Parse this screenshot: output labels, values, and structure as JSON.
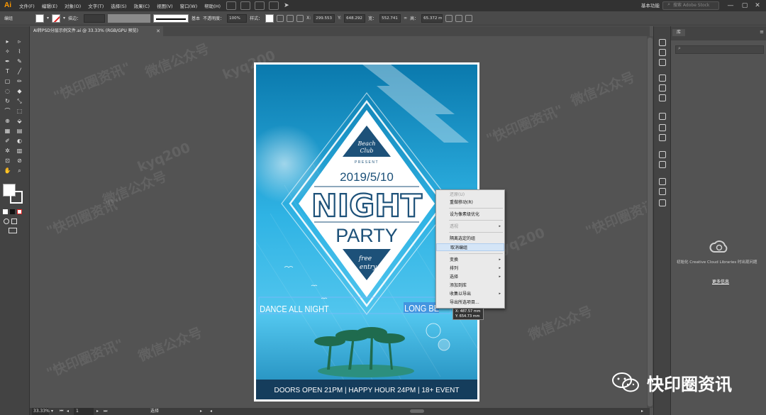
{
  "app": {
    "logo": "Ai"
  },
  "menubar": {
    "items": [
      "文件(F)",
      "编辑(E)",
      "对象(O)",
      "文字(T)",
      "选择(S)",
      "效果(C)",
      "视图(V)",
      "窗口(W)",
      "帮助(H)"
    ],
    "workspace": "基本功能",
    "search_placeholder": "搜索 Adobe Stock",
    "window_controls": [
      "—",
      "▢",
      "✕"
    ]
  },
  "controlbar": {
    "group_label": "编组",
    "stroke_label": "描边：",
    "stroke_style": "基本",
    "opacity_label": "不透明度：",
    "opacity_value": "100%",
    "style_label": "样式：",
    "x_label": "X:",
    "x_value": "299.553",
    "y_label": "Y:",
    "y_value": "648.292",
    "w_label": "宽：",
    "w_value": "552.741",
    "h_label": "高：",
    "h_value": "65.372 m"
  },
  "document": {
    "tab_title": "AI转PSD分层示例文件.ai @ 33.33% (RGB/GPU 预览)",
    "tab_close": "✕"
  },
  "statusbar": {
    "zoom": "33.33%",
    "page": "1",
    "tool_name": "选择"
  },
  "poster": {
    "badge_top": "Beach",
    "badge_bottom": "Club",
    "present": "PRESENT",
    "date": "2019/5/10",
    "headline": "NIGHT",
    "subheadline": "PARTY",
    "free_top": "free",
    "free_bottom": "entry",
    "left_banner": "DANCE ALL NIGHT",
    "right_banner": "LONG BE",
    "footer": "DOORS OPEN 21PM | HAPPY HOUR 24PM | 18+ EVENT",
    "colors": {
      "bg_top": "#0b82b8",
      "bg_mid": "#35b7e6",
      "navy": "#1d4f76",
      "footer": "#143a58"
    }
  },
  "context_menu": {
    "items": [
      {
        "label": "还原(U)",
        "disabled": true
      },
      {
        "label": "重做移动(R)",
        "disabled": false
      },
      {
        "label": "设为像素级优化",
        "disabled": false
      },
      {
        "label": "透视",
        "disabled": true,
        "submenu": true
      },
      {
        "label": "隔离选定的组",
        "disabled": false
      },
      {
        "label": "取消编组",
        "disabled": false,
        "hover": true
      },
      {
        "label": "变换",
        "disabled": false,
        "submenu": true
      },
      {
        "label": "排列",
        "disabled": false,
        "submenu": true
      },
      {
        "label": "选择",
        "disabled": false,
        "submenu": true
      },
      {
        "label": "添加到库",
        "disabled": false
      },
      {
        "label": "收集以导出",
        "disabled": false,
        "submenu": true
      },
      {
        "label": "导出所选项目...",
        "disabled": false
      }
    ],
    "tooltip_x": "X: 487.57 mm",
    "tooltip_y": "Y: 654.73 mm"
  },
  "libraries": {
    "tab_label": "库",
    "message": "初始化 Creative Cloud Libraries 时出现问题",
    "more_link": "更多信息"
  },
  "watermark": {
    "text1": "\"快印圈资讯\"",
    "text2": "微信公众号",
    "text3": "kyq200",
    "brand": "快印圈资讯"
  }
}
